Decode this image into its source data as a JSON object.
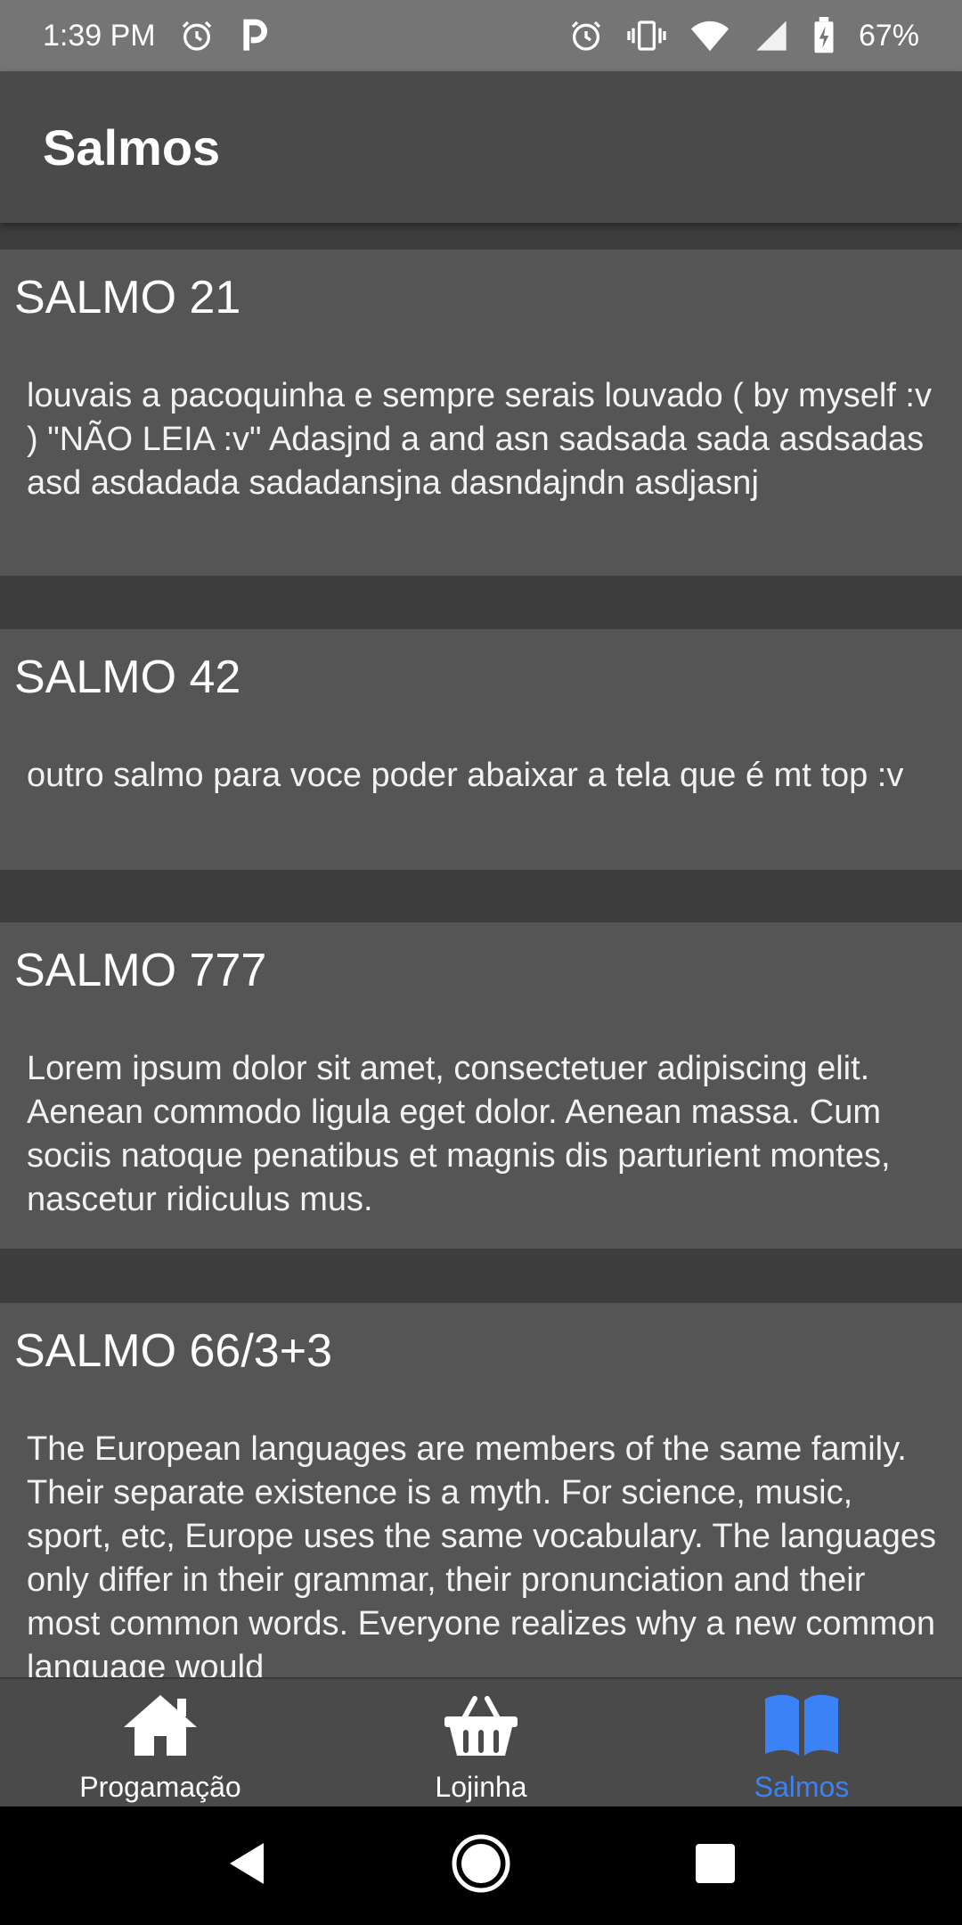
{
  "status_bar": {
    "time": "1:39 PM",
    "battery": "67%",
    "left_icons": [
      "alarm-icon",
      "p-app-icon"
    ],
    "right_icons": [
      "alarm-icon",
      "vibrate-icon",
      "wifi-icon",
      "signal-icon",
      "battery-icon"
    ]
  },
  "app_bar": {
    "title": "Salmos"
  },
  "psalms": [
    {
      "title": "SALMO 21",
      "text": "louvais a pacoquinha e sempre serais louvado ( by myself :v ) \"NÃO LEIA :v\" Adasjnd a and asn  sadsada sada  asdsadas  asd asdadada sadadansjna dasndajndn asdjasnj"
    },
    {
      "title": "SALMO 42",
      "text": "outro salmo para voce poder abaixar a tela que é mt top :v"
    },
    {
      "title": "SALMO 777",
      "text": "Lorem ipsum dolor sit amet, consectetuer adipiscing elit. Aenean commodo ligula eget dolor. Aenean massa. Cum sociis natoque penatibus et magnis dis parturient montes, nascetur ridiculus mus."
    },
    {
      "title": "SALMO 66/3+3",
      "text": "The European languages are members of the same family. Their separate existence is a myth. For science, music, sport, etc, Europe uses the same vocabulary. The languages only differ in their grammar, their pronunciation and their most common words. Everyone realizes why a new common language would"
    }
  ],
  "bottom_nav": {
    "items": [
      {
        "label": "Progamação",
        "icon": "home-icon"
      },
      {
        "label": "Lojinha",
        "icon": "basket-icon"
      },
      {
        "label": "Salmos",
        "icon": "book-icon",
        "active": true
      }
    ]
  },
  "colors": {
    "background": "#3d3d3d",
    "card": "#555555",
    "app_bar": "#4a4a4a",
    "accent": "#3b82f6"
  }
}
